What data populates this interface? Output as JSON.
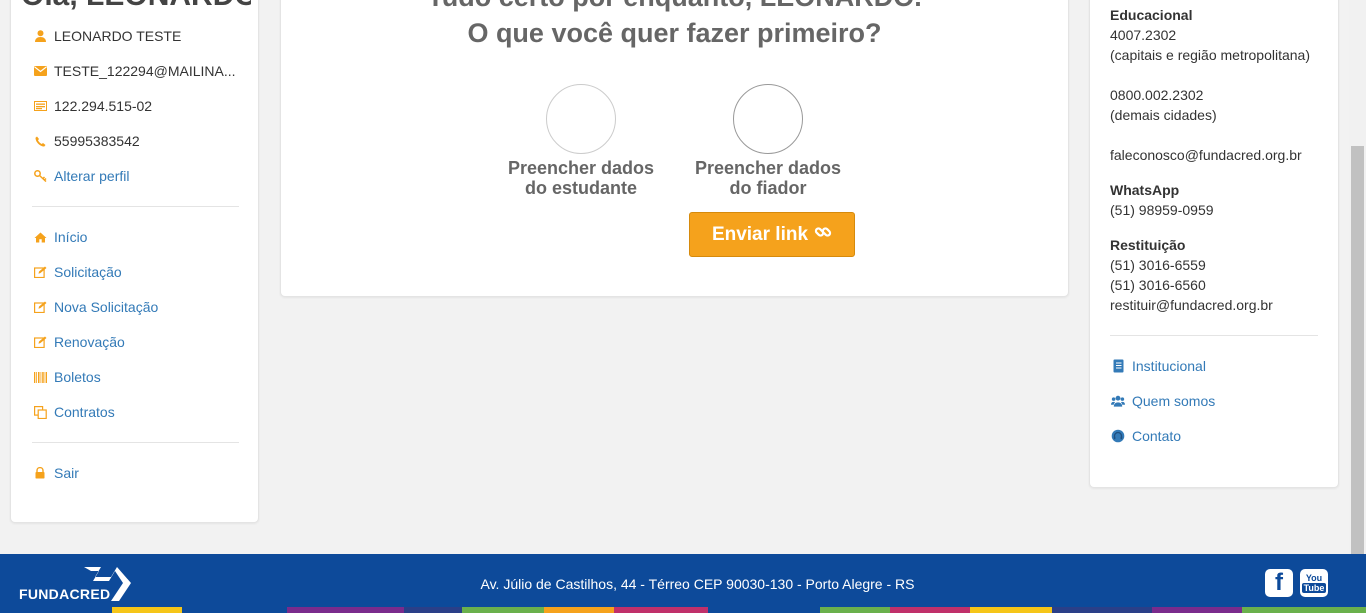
{
  "left": {
    "greeting": "Olá, LEONARDO.",
    "profile": [
      {
        "icon": "user-icon",
        "text": "LEONARDO TESTE"
      },
      {
        "icon": "envelope-icon",
        "text": "TESTE_122294@MAILINA..."
      },
      {
        "icon": "id-card-icon",
        "text": "122.294.515-02"
      },
      {
        "icon": "phone-icon",
        "text": "55995383542"
      },
      {
        "icon": "key-icon",
        "text": "Alterar perfil"
      }
    ],
    "menu": [
      {
        "icon": "home-icon",
        "text": "Início"
      },
      {
        "icon": "edit-icon",
        "text": "Solicitação"
      },
      {
        "icon": "edit-icon",
        "text": "Nova Solicitação"
      },
      {
        "icon": "edit-icon",
        "text": "Renovação"
      },
      {
        "icon": "barcode-icon",
        "text": "Boletos"
      },
      {
        "icon": "copy-icon",
        "text": "Contratos"
      }
    ],
    "logout": {
      "icon": "lock-icon",
      "text": "Sair"
    }
  },
  "main": {
    "headline_line1": "Tudo certo por enquanto, LEONARDO.",
    "headline_line2": "O que você quer fazer primeiro?",
    "step1_line1": "Preencher dados",
    "step1_line2": "do estudante",
    "step2_line1": "Preencher dados",
    "step2_line2": "do fiador",
    "send_button": "Enviar link"
  },
  "right": {
    "section_title": "Educacional",
    "phone1": "4007.2302",
    "phone1_note": "(capitais e região metropolitana)",
    "phone2": "0800.002.2302",
    "phone2_note": "(demais cidades)",
    "email": "faleconosco@fundacred.org.br",
    "whatsapp_title": "WhatsApp",
    "whatsapp_number": "(51) 98959-0959",
    "restituicao_title": "Restituição",
    "restituicao_phone1": "(51) 3016-6559",
    "restituicao_phone2": "(51) 3016-6560",
    "restituicao_email": "restituir@fundacred.org.br",
    "links": [
      {
        "icon": "book-icon",
        "text": "Institucional"
      },
      {
        "icon": "users-icon",
        "text": "Quem somos"
      },
      {
        "icon": "headset-icon",
        "text": "Contato"
      }
    ]
  },
  "footer": {
    "logo_text": "FUNDACRED",
    "address": "Av. Júlio de Castilhos, 44 - Térreo CEP 90030-130 - Porto Alegre - RS",
    "facebook": "f",
    "youtube_top": "You",
    "youtube_bottom": "Tube"
  },
  "colors": {
    "accent": "#f5a21c",
    "link": "#337ab7",
    "footer": "#0d4a9a"
  }
}
